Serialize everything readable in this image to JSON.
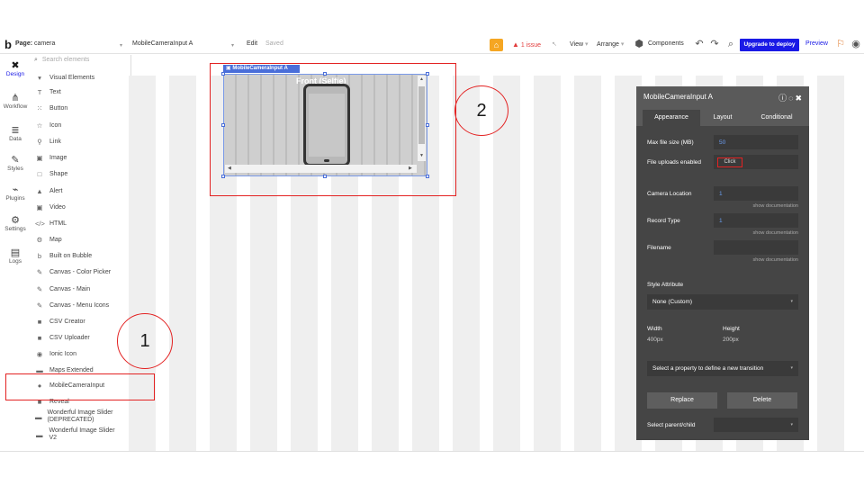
{
  "topbar": {
    "logo": "b",
    "page_label": "Page:",
    "page_name": "camera",
    "element_name": "MobileCameraInput A",
    "edit_label": "Edit",
    "saved_label": "Saved",
    "issue_label": "1 issue",
    "view_label": "View",
    "arrange_label": "Arrange",
    "components_label": "Components",
    "deploy_label": "Upgrade to deploy",
    "preview_label": "Preview"
  },
  "rail": [
    {
      "label": "Design",
      "icon": "design-icon",
      "glyph": "✖"
    },
    {
      "label": "Workflow",
      "icon": "workflow-icon",
      "glyph": "⋔"
    },
    {
      "label": "Data",
      "icon": "data-icon",
      "glyph": "≣"
    },
    {
      "label": "Styles",
      "icon": "styles-icon",
      "glyph": "✎"
    },
    {
      "label": "Plugins",
      "icon": "plugins-icon",
      "glyph": "⌁"
    },
    {
      "label": "Settings",
      "icon": "settings-icon",
      "glyph": "⚙"
    },
    {
      "label": "Logs",
      "icon": "logs-icon",
      "glyph": "▤"
    }
  ],
  "palette": {
    "search_placeholder": "Search elements",
    "items": [
      {
        "label": "Visual Elements",
        "icon": "caret-down-icon",
        "glyph": "▾"
      },
      {
        "label": "Text",
        "icon": "text-icon",
        "glyph": "T"
      },
      {
        "label": "Button",
        "icon": "button-icon",
        "glyph": "⁙"
      },
      {
        "label": "Icon",
        "icon": "star-icon",
        "glyph": "☆"
      },
      {
        "label": "Link",
        "icon": "link-icon",
        "glyph": "⚲"
      },
      {
        "label": "Image",
        "icon": "image-icon",
        "glyph": "▣"
      },
      {
        "label": "Shape",
        "icon": "shape-icon",
        "glyph": "□"
      },
      {
        "label": "Alert",
        "icon": "alert-icon",
        "glyph": "▲"
      },
      {
        "label": "Video",
        "icon": "video-icon",
        "glyph": "▣"
      },
      {
        "label": "HTML",
        "icon": "html-icon",
        "glyph": "</>"
      },
      {
        "label": "Map",
        "icon": "map-icon",
        "glyph": "⚙"
      },
      {
        "label": "Built on Bubble",
        "icon": "bubble-icon",
        "glyph": "b"
      },
      {
        "label": "Canvas - Color Picker",
        "icon": "brush-icon",
        "glyph": "✎"
      },
      {
        "label": "Canvas - Main",
        "icon": "brush-icon",
        "glyph": "✎"
      },
      {
        "label": "Canvas - Menu Icons",
        "icon": "brush-icon",
        "glyph": "✎"
      },
      {
        "label": "CSV Creator",
        "icon": "square-icon",
        "glyph": "■"
      },
      {
        "label": "CSV Uploader",
        "icon": "square-icon",
        "glyph": "■"
      },
      {
        "label": "Ionic Icon",
        "icon": "ionic-icon",
        "glyph": "◉"
      },
      {
        "label": "Maps Extended",
        "icon": "map-icon",
        "glyph": "▬"
      },
      {
        "label": "MobileCameraInput",
        "icon": "camera-icon",
        "glyph": "●"
      },
      {
        "label": "Reveal",
        "icon": "square-icon",
        "glyph": "■"
      },
      {
        "label": "Wonderful Image Slider (DEPRECATED)",
        "icon": "slider-icon",
        "glyph": "▬"
      },
      {
        "label": "Wonderful Image Slider V2",
        "icon": "slider-icon",
        "glyph": "▬"
      }
    ]
  },
  "canvas": {
    "element_tag": "MobileCameraInput A",
    "camera_title": "Front (Selfie)"
  },
  "annotations": {
    "circle_1": "1",
    "circle_2": "2"
  },
  "panel": {
    "title": "MobileCameraInput A",
    "tabs": [
      "Appearance",
      "Layout",
      "Conditional"
    ],
    "max_file_size_label": "Max file size (MB)",
    "max_file_size_value": "50",
    "file_uploads_label": "File uploads enabled",
    "file_uploads_button": "Click",
    "camera_location_label": "Camera Location",
    "camera_location_value": "1",
    "record_type_label": "Record Type",
    "record_type_value": "1",
    "filename_label": "Filename",
    "show_documentation": "show documentation",
    "style_attribute_label": "Style Attribute",
    "style_value": "None (Custom)",
    "width_label": "Width",
    "width_value": "400px",
    "height_label": "Height",
    "height_value": "200px",
    "transition_placeholder": "Select a property to define a new transition",
    "replace_label": "Replace",
    "delete_label": "Delete",
    "select_parent_label": "Select parent/child"
  }
}
